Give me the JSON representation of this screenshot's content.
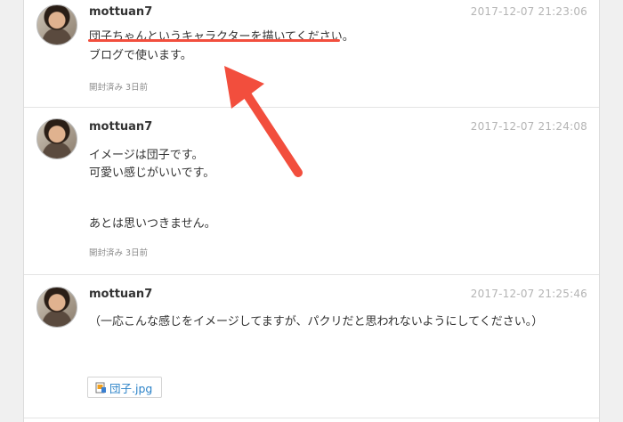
{
  "messages": [
    {
      "username": "mottuan7",
      "timestamp": "2017-12-07 21:23:06",
      "lines": [
        "団子ちゃんというキャラクターを描いてください。",
        "ブログで使います。"
      ],
      "status": "開封済み 3日前"
    },
    {
      "username": "mottuan7",
      "timestamp": "2017-12-07 21:24:08",
      "lines": [
        "イメージは団子です。",
        "可愛い感じがいいです。",
        "あとは思いつきません。"
      ],
      "status": "開封済み 3日前"
    },
    {
      "username": "mottuan7",
      "timestamp": "2017-12-07 21:25:46",
      "lines": [
        "（一応こんな感じをイメージしてますが、パクリだと思われないようにしてください。）"
      ],
      "attachment": {
        "filename": "団子.jpg",
        "icon": "image-file-icon"
      }
    }
  ],
  "annotations": {
    "color": "#f24e3d",
    "underline": "underline-annotation",
    "arrow": "arrow-annotation"
  }
}
